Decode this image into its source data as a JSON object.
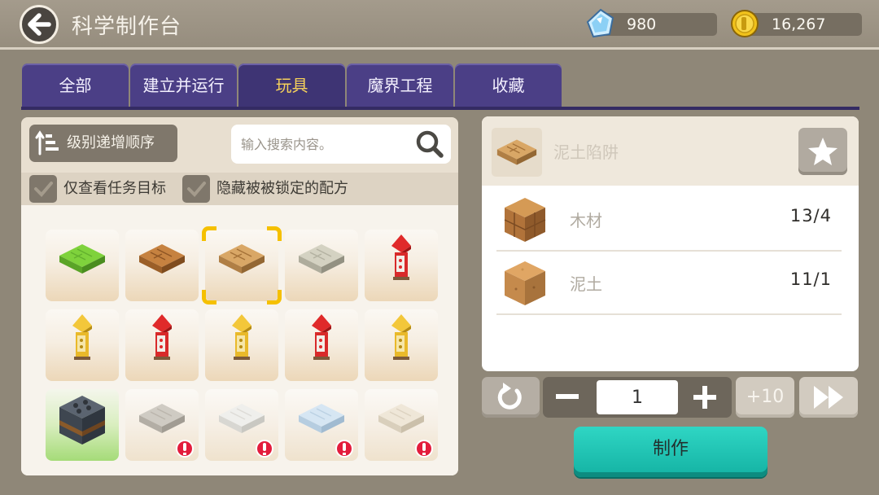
{
  "header": {
    "title": "科学制作台",
    "gems": "980",
    "coins": "16,267"
  },
  "tabs": [
    {
      "label": "全部"
    },
    {
      "label": "建立并运行"
    },
    {
      "label": "玩具"
    },
    {
      "label": "魔界工程"
    },
    {
      "label": "收藏"
    }
  ],
  "active_tab": "玩具",
  "toolbar": {
    "sort_label": "级别递增顺序",
    "search_placeholder": "输入搜索内容。"
  },
  "filters": [
    {
      "label": "仅查看任务目标",
      "checked": true
    },
    {
      "label": "隐藏被被锁定的配方",
      "checked": true
    }
  ],
  "recipes": [
    {
      "icon": "grass-trap-icon",
      "locked": false
    },
    {
      "icon": "wood-trap-icon",
      "locked": false
    },
    {
      "icon": "dirt-trap-icon",
      "locked": false,
      "selected": true
    },
    {
      "icon": "stone-trap-icon",
      "locked": false
    },
    {
      "icon": "red-firework-icon",
      "locked": false
    },
    {
      "icon": "yellow-firework-icon",
      "locked": false
    },
    {
      "icon": "red-firework-icon",
      "locked": false
    },
    {
      "icon": "yellow-firework-icon",
      "locked": false
    },
    {
      "icon": "red-firework-icon",
      "locked": false
    },
    {
      "icon": "yellow-firework-icon",
      "locked": false
    },
    {
      "icon": "launcher-block-icon",
      "locked": false
    },
    {
      "icon": "gray-trap-icon",
      "locked": true
    },
    {
      "icon": "white-trap-icon",
      "locked": true
    },
    {
      "icon": "ice-trap-icon",
      "locked": true
    },
    {
      "icon": "sand-trap-icon",
      "locked": true
    }
  ],
  "detail": {
    "name": "泥土陷阱",
    "ingredients": [
      {
        "name": "木材",
        "count": "13/4",
        "icon": "wood-block-icon"
      },
      {
        "name": "泥土",
        "count": "11/1",
        "icon": "dirt-block-icon"
      }
    ]
  },
  "craft": {
    "quantity": "1",
    "plus10_label": "+10",
    "make_label": "制作"
  },
  "colors": {
    "tab_bg": "#4b3f86",
    "tab_active_text": "#f7d25a",
    "make_button": "#1fc4b3",
    "warning": "#e31c3c",
    "selection": "#f5c000"
  }
}
